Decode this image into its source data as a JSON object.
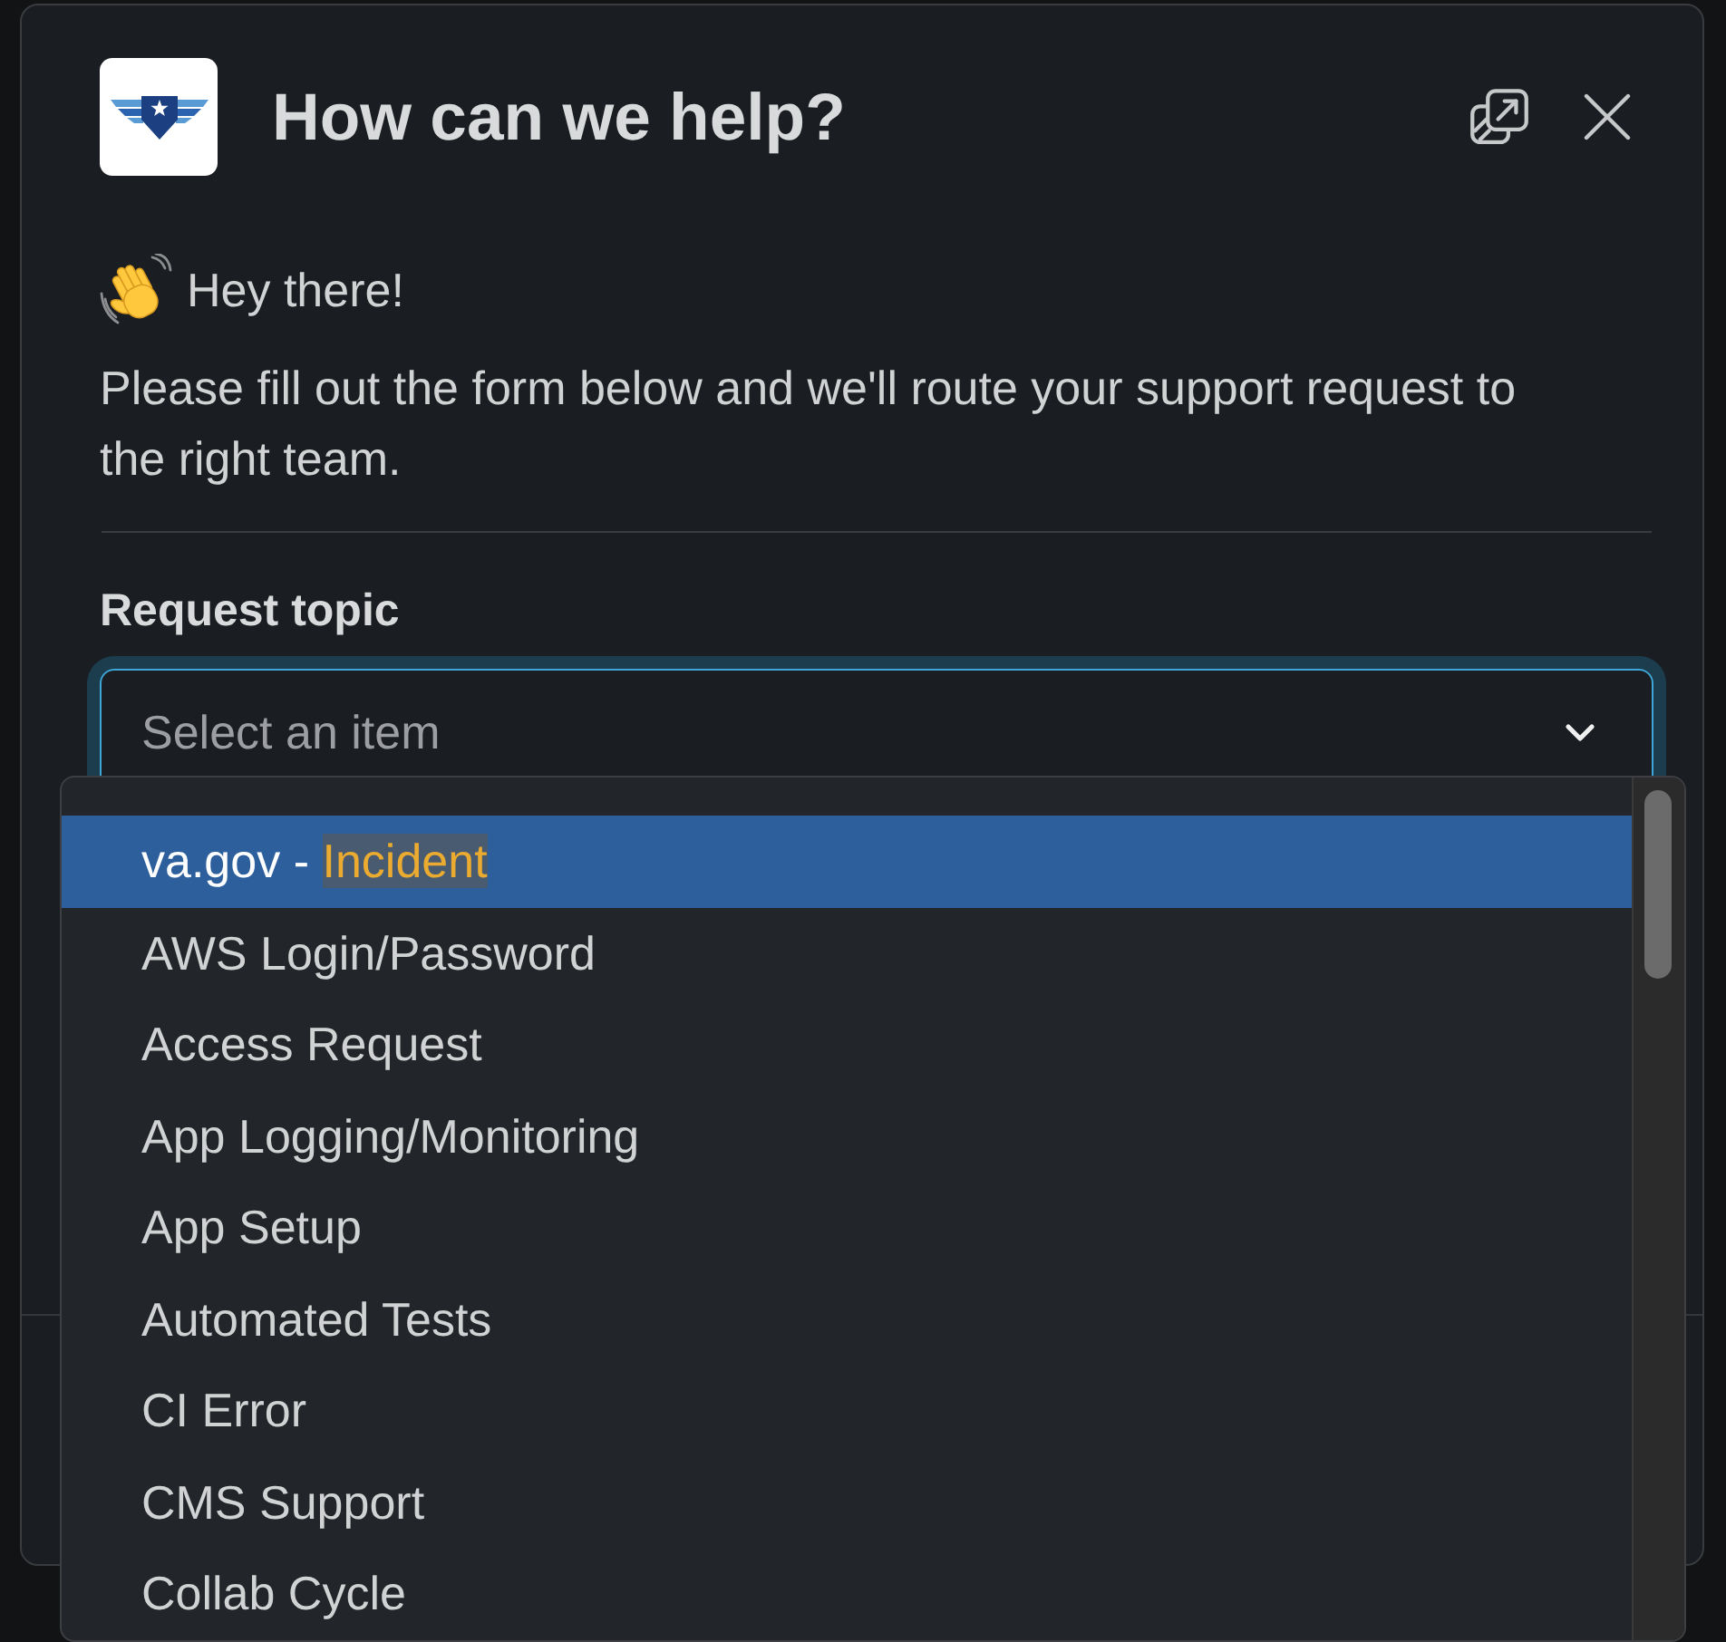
{
  "dialog": {
    "title": "How can we help?"
  },
  "greeting": "Hey there!",
  "intro": "Please fill out the form below and we'll route your support request to the right team.",
  "request_topic": {
    "label": "Request topic",
    "placeholder": "Select an item",
    "expanded": true
  },
  "options": [
    {
      "label": "va.gov -",
      "highlight": "Incident",
      "selected": true
    },
    {
      "label": "AWS Login/Password",
      "selected": false
    },
    {
      "label": "Access Request",
      "selected": false
    },
    {
      "label": "App Logging/Monitoring",
      "selected": false
    },
    {
      "label": "App Setup",
      "selected": false
    },
    {
      "label": "Automated Tests",
      "selected": false
    },
    {
      "label": "CI Error",
      "selected": false
    },
    {
      "label": "CMS Support",
      "selected": false
    },
    {
      "label": "Collab Cycle",
      "selected": false
    }
  ]
}
